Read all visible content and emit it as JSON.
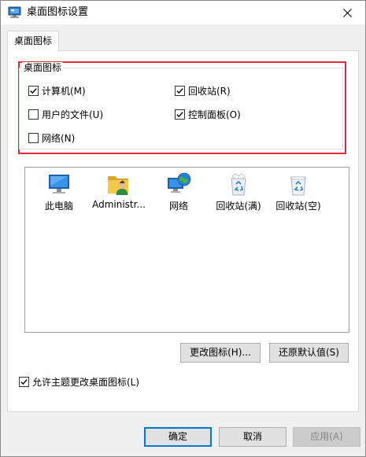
{
  "window": {
    "title": "桌面图标设置"
  },
  "tabs": [
    {
      "label": "桌面图标"
    }
  ],
  "group": {
    "legend": "桌面图标",
    "checkboxes": [
      {
        "label": "计算机(M)",
        "checked": true
      },
      {
        "label": "回收站(R)",
        "checked": true
      },
      {
        "label": "用户的文件(U)",
        "checked": false
      },
      {
        "label": "控制面板(O)",
        "checked": true
      },
      {
        "label": "网络(N)",
        "checked": false
      }
    ]
  },
  "icons": [
    {
      "label": "此电脑",
      "icon": "computer-icon"
    },
    {
      "label": "Administr...",
      "icon": "user-folder-icon"
    },
    {
      "label": "网络",
      "icon": "network-icon"
    },
    {
      "label": "回收站(满)",
      "icon": "recycle-bin-full-icon"
    },
    {
      "label": "回收站(空)",
      "icon": "recycle-bin-empty-icon"
    }
  ],
  "buttons": {
    "change_icon": "更改图标(H)...",
    "restore_default": "还原默认值(S)",
    "ok": "确定",
    "cancel": "取消",
    "apply": "应用(A)"
  },
  "theme_checkbox": {
    "label": "允许主题更改桌面图标(L)",
    "checked": true
  },
  "colors": {
    "highlight": "#e02a35",
    "accent": "#0078d7"
  }
}
